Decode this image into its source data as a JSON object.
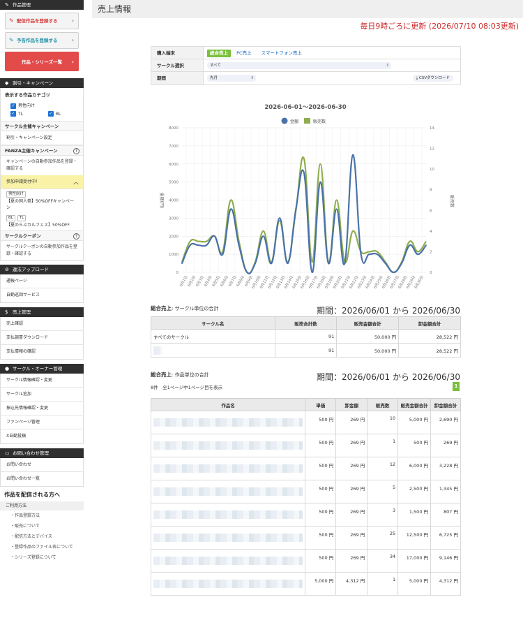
{
  "sidebar": {
    "works": {
      "title": "作品管理",
      "btn_register": "配信作品を登録する",
      "btn_preorder": "予告作品を登録する",
      "btn_list": "作品・シリーズ一覧"
    },
    "campaign": {
      "title": "割引・キャンペーン",
      "category_title": "表示する作品カテゴリ",
      "cat_male": "男性向け",
      "cat_tl": "TL",
      "cat_bl": "BL",
      "circle_campaign_title": "サークル主催キャンペーン",
      "discount_link": "割引・キャンペーン設定",
      "fanza_title": "FANZA主催キャンペーン",
      "fanza_desc": "キャンペーンの自動参加作品を登録・確認する",
      "accepting": "参加申請受付中！",
      "tag_male": "男性向け",
      "camp1": "【夏の同人祭】50%OFFキャンペーン",
      "tag_bl": "BL",
      "tag_tl": "TL",
      "camp2": "【夏のらぶカルフェス】50%OFF",
      "coupon_title": "サークルクーポン",
      "coupon_desc": "サークルクーポンの自動参加作品を登録・確認する"
    },
    "illegal": {
      "title": "違法アップロード",
      "items": [
        "通報ページ",
        "自動巡回サービス"
      ]
    },
    "sales": {
      "title": "売上管理",
      "items": [
        "売上確認",
        "支払調書ダウンロード",
        "支払情報の確認"
      ]
    },
    "circle": {
      "title": "サークル・オーナー管理",
      "items": [
        "サークル情報確認・変更",
        "サークル追加",
        "振込先情報確認・変更",
        "ファンページ管理",
        "X自動投稿"
      ]
    },
    "inquiry": {
      "title": "お問い合わせ管理",
      "items": [
        "お問い合わせ",
        "お問い合わせ一覧"
      ]
    },
    "guide": {
      "title": "作品を配信される方へ",
      "sub": "ご利用方法",
      "items": [
        "・作品登録方法",
        "・販売について",
        "・配信方法とデバイス",
        "・登録作品のファイル名について",
        "・シリーズ登録について"
      ]
    }
  },
  "main": {
    "title": "売上情報",
    "update_note": "毎日9時ごろに更新 (2026/07/10 08:03更新)",
    "filter": {
      "device_label": "購入端末",
      "device_tabs": [
        "総合売上",
        "PC売上",
        "スマートフォン売上"
      ],
      "circle_label": "サークル選択",
      "circle_value": "すべて",
      "period_label": "期間",
      "period_value": "先月",
      "csv_label": "CSVダウンロード"
    },
    "summary": {
      "title_bold": "総合売上",
      "title_rest": ": サークル単位の合計",
      "period": "期間：2026/06/01 から 2026/06/30",
      "headers": [
        "サークル名",
        "販売合計数",
        "販売金額合計",
        "卸金額合計"
      ],
      "rows": [
        {
          "name": "すべてのサークル",
          "count": "91",
          "sales": "50,000 円",
          "wholesale": "28,522 円"
        },
        {
          "name": "",
          "count": "91",
          "sales": "50,000 円",
          "wholesale": "28,522 円"
        }
      ]
    },
    "works": {
      "title_bold": "総合売上",
      "title_rest": ": 作品単位の合計",
      "period": "期間：2026/06/01 から 2026/06/30",
      "info": "8件　全1ページ中1ページ目を表示",
      "page": "1",
      "headers": [
        "作品名",
        "単価",
        "卸金額",
        "販売数",
        "販売金額合計",
        "卸金額合計"
      ],
      "rows": [
        {
          "price": "500 円",
          "wholesale": "269 円",
          "count": "10",
          "sales_total": "5,000 円",
          "wholesale_total": "2,690 円"
        },
        {
          "price": "500 円",
          "wholesale": "269 円",
          "count": "1",
          "sales_total": "500 円",
          "wholesale_total": "269 円"
        },
        {
          "price": "500 円",
          "wholesale": "269 円",
          "count": "12",
          "sales_total": "6,000 円",
          "wholesale_total": "3,228 円"
        },
        {
          "price": "500 円",
          "wholesale": "269 円",
          "count": "5",
          "sales_total": "2,500 円",
          "wholesale_total": "1,345 円"
        },
        {
          "price": "500 円",
          "wholesale": "269 円",
          "count": "3",
          "sales_total": "1,500 円",
          "wholesale_total": "807 円"
        },
        {
          "price": "500 円",
          "wholesale": "269 円",
          "count": "25",
          "sales_total": "12,500 円",
          "wholesale_total": "6,725 円"
        },
        {
          "price": "500 円",
          "wholesale": "269 円",
          "count": "34",
          "sales_total": "17,000 円",
          "wholesale_total": "9,146 円"
        },
        {
          "price": "5,000 円",
          "wholesale": "4,312 円",
          "count": "1",
          "sales_total": "5,000 円",
          "wholesale_total": "4,312 円"
        }
      ]
    }
  },
  "chart_data": {
    "type": "line",
    "title": "2026-06-01〜2026-06-30",
    "ylabel": "金額(円)",
    "y2label": "販売数",
    "ylim": [
      0,
      8000
    ],
    "y2lim": [
      0,
      14
    ],
    "yticks": [
      0,
      1000,
      2000,
      3000,
      4000,
      5000,
      6000,
      7000,
      8000
    ],
    "y2ticks": [
      0,
      2,
      4,
      6,
      8,
      10,
      12,
      14
    ],
    "x": [
      "6月1日",
      "6月2日",
      "6月3日",
      "6月4日",
      "6月5日",
      "6月6日",
      "6月7日",
      "6月8日",
      "6月9日",
      "6月10日",
      "6月11日",
      "6月12日",
      "6月13日",
      "6月14日",
      "6月15日",
      "6月16日",
      "6月17日",
      "6月18日",
      "6月19日",
      "6月20日",
      "6月21日",
      "6月22日",
      "6月23日",
      "6月24日",
      "6月25日",
      "6月26日",
      "6月27日",
      "6月28日",
      "6月29日",
      "6月30日"
    ],
    "series": [
      {
        "name": "金額",
        "axis": "left",
        "color": "#4a72a8",
        "values": [
          500,
          1500,
          1500,
          1500,
          2000,
          1000,
          3500,
          1500,
          0,
          500,
          2000,
          500,
          3000,
          500,
          3500,
          5500,
          0,
          5000,
          500,
          3500,
          500,
          6500,
          1000,
          1000,
          1000,
          500,
          0,
          500,
          1500,
          1000,
          1500
        ]
      },
      {
        "name": "販売数",
        "axis": "right",
        "color": "#8fad4f",
        "values": [
          1,
          3,
          3,
          3,
          3.5,
          2,
          7,
          3,
          0,
          1,
          4,
          1,
          5,
          1,
          6,
          11,
          1,
          10.5,
          1,
          7,
          1,
          4,
          2,
          2,
          2,
          1,
          0,
          1,
          3,
          2,
          3
        ]
      }
    ],
    "legend": "top-center",
    "grid": true
  }
}
